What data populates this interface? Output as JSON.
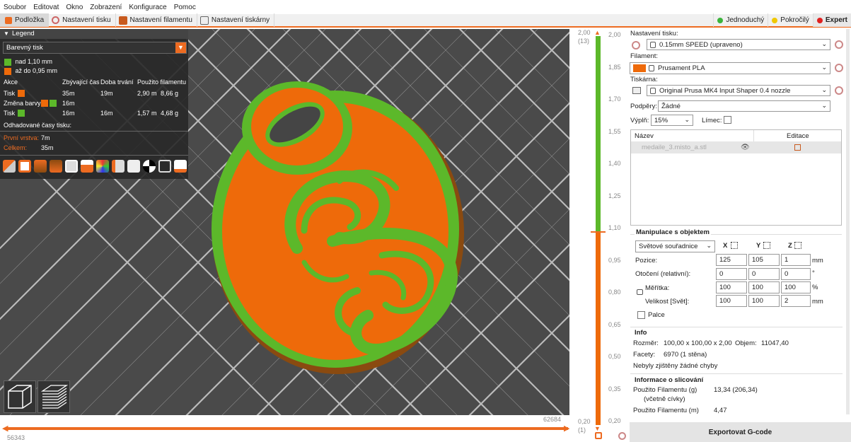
{
  "menu": [
    "Soubor",
    "Editovat",
    "Okno",
    "Zobrazení",
    "Konfigurace",
    "Pomoc"
  ],
  "tabs": [
    {
      "label": "Podložka",
      "active": true
    },
    {
      "label": "Nastavení tisku",
      "active": false
    },
    {
      "label": "Nastavení filamentu",
      "active": false
    },
    {
      "label": "Nastavení tiskárny",
      "active": false
    }
  ],
  "modes": [
    {
      "label": "Jednoduchý",
      "color": "#3cb43c"
    },
    {
      "label": "Pokročilý",
      "color": "#f0c800"
    },
    {
      "label": "Expert",
      "color": "#e02020"
    }
  ],
  "legend": {
    "title": "Legend",
    "view_type": "Barevný tisk",
    "ranges": [
      {
        "label": "nad 1,10 mm",
        "color": "#5cb82a"
      },
      {
        "label": "až do 0,95 mm",
        "color": "#ee6a0a"
      }
    ],
    "headers": [
      "Akce",
      "Zbývající čas",
      "Doba trvání",
      "Použito filamentu"
    ],
    "rows": [
      {
        "action": "Tisk",
        "colors": [
          "#ee6a0a"
        ],
        "remaining": "35m",
        "duration": "19m",
        "length": "2,90 m",
        "weight": "8,66 g"
      },
      {
        "action": "Změna barvy",
        "colors": [
          "#ee6a0a",
          "#5cb82a"
        ],
        "remaining": "16m",
        "duration": "",
        "length": "",
        "weight": ""
      },
      {
        "action": "Tisk",
        "colors": [
          "#5cb82a"
        ],
        "remaining": "16m",
        "duration": "16m",
        "length": "1,57 m",
        "weight": "4,68 g"
      }
    ],
    "estimated_title": "Odhadované časy tisku:",
    "first_layer_label": "První vrstva:",
    "first_layer_value": "7m",
    "total_label": "Celkem:",
    "total_value": "35m"
  },
  "hslider": {
    "left": "56343",
    "right": "62684"
  },
  "vslider": {
    "top_value": "2,00",
    "top_layer": "(13)",
    "bottom_value": "0,20",
    "bottom_layer": "(1)",
    "ticks": [
      "2,00",
      "1,85",
      "1,70",
      "1,55",
      "1,40",
      "1,25",
      "1,10",
      "0,95",
      "0,80",
      "0,65",
      "0,50",
      "0,35",
      "0,20"
    ],
    "change_fraction": 0.5
  },
  "panel": {
    "print_settings_label": "Nastavení tisku:",
    "print_settings_value": "0.15mm SPEED (upraveno)",
    "filament_label": "Filament:",
    "filament_value": "Prusament PLA",
    "filament_color": "#ee6a0a",
    "printer_label": "Tiskárna:",
    "printer_value": "Original Prusa MK4 Input Shaper 0.4 nozzle",
    "supports_label": "Podpěry:",
    "supports_value": "Žádné",
    "infill_label": "Výplň:",
    "infill_value": "15%",
    "brim_label": "Límec:",
    "list_headers": [
      "Název",
      "Editace"
    ],
    "object_name": "medaile_3.misto_a.stl",
    "manip_title": "Manipulace s objektem",
    "coord_value": "Světové souřadnice",
    "axes": [
      "X",
      "Y",
      "Z"
    ],
    "position_label": "Pozice:",
    "position": [
      "125",
      "105",
      "1"
    ],
    "position_unit": "mm",
    "rotation_label": "Otočení (relativní):",
    "rotation": [
      "0",
      "0",
      "0"
    ],
    "rotation_unit": "°",
    "scale_label": "Měřítka:",
    "scale": [
      "100",
      "100",
      "100"
    ],
    "scale_unit": "%",
    "size_label": "Velikost [Svět]:",
    "size": [
      "100",
      "100",
      "2"
    ],
    "size_unit": "mm",
    "inches_label": "Palce",
    "info_title": "Info",
    "size_info_label": "Rozměr:",
    "size_info_value": "100,00 x 100,00 x 2,00",
    "volume_label": "Objem:",
    "volume_value": "11047,40",
    "facets_label": "Facety:",
    "facets_value": "6970 (1 stěna)",
    "errors_text": "Nebyly zjištěny žádné chyby",
    "slice_title": "Informace o slicování",
    "filament_g_label": "Použito Filamentu (g)",
    "filament_g_value": "13,34 (206,34)",
    "filament_g_sub": "(včetně cívky)",
    "filament_m_label": "Použito Filamentu (m)",
    "filament_m_value": "4,47",
    "export_label": "Exportovat G-code"
  }
}
